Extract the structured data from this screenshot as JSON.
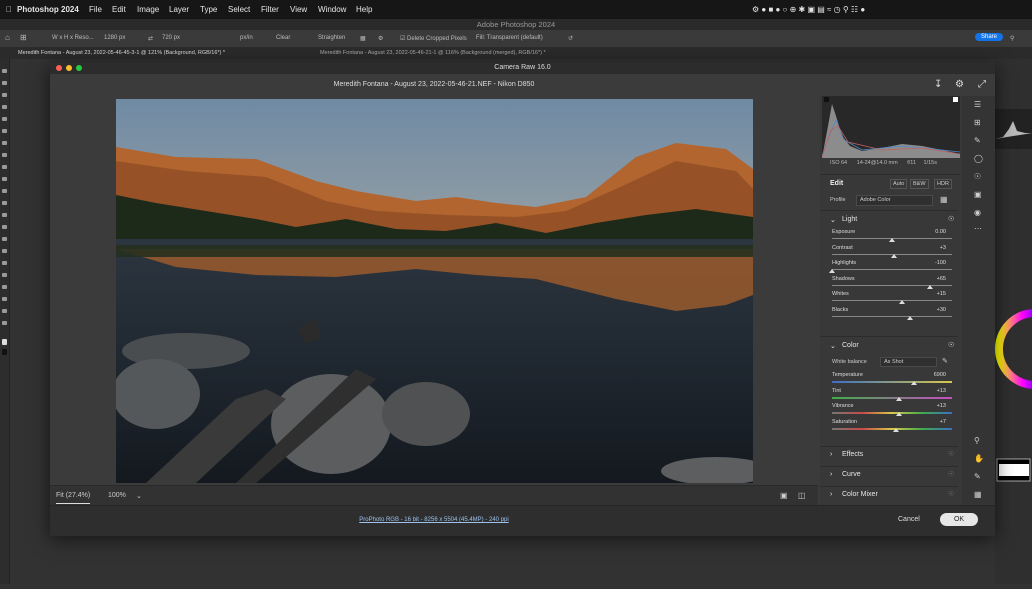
{
  "menubar": {
    "app": "Photoshop 2024",
    "items": [
      "File",
      "Edit",
      "Image",
      "Layer",
      "Type",
      "Select",
      "Filter",
      "View",
      "Window",
      "Help"
    ]
  },
  "ps_title": "Adobe Photoshop 2024",
  "options": {
    "ratio": "W x H x Reso...",
    "width": "1280 px",
    "height": "720 px",
    "unit": "px/in",
    "clear": "Clear",
    "straighten": "Straighten",
    "delete_cropped": "Delete Cropped Pixels",
    "fill": "Fill: Transparent (default)",
    "share": "Share"
  },
  "tabs": [
    "Meredith Fontana - August 23, 2022-05-46-45-3-1 @ 121% (Background, RGB/16*) *",
    "Meredith Fontana - August 23, 2022-05-46-21-1 @ 116% (Background (merged), RGB/16*) *"
  ],
  "camera_raw": {
    "title": "Camera Raw 16.0",
    "file_title": "Meredith Fontana - August 23, 2022-05-46-21.NEF  -  Nikon D850",
    "zoom_fit": "Fit (27.4%)",
    "zoom_100": "100%",
    "footer_info": "ProPhoto RGB - 16 bit - 8256 x 5504 (45.4MP) - 240 ppi",
    "cancel": "Cancel",
    "ok": "OK"
  },
  "meta": {
    "iso": "ISO 64",
    "lens": "14-24@14.0 mm",
    "aperture": "f/11",
    "shutter": "1/15s"
  },
  "edit": {
    "title": "Edit",
    "auto": "Auto",
    "bw": "B&W",
    "hdr": "HDR",
    "profile_label": "Profile",
    "profile_value": "Adobe Color"
  },
  "light": {
    "title": "Light",
    "sliders": [
      {
        "label": "Exposure",
        "value": "0.00",
        "pos": 0.5
      },
      {
        "label": "Contrast",
        "value": "+3",
        "pos": 0.52
      },
      {
        "label": "Highlights",
        "value": "-100",
        "pos": 0.0
      },
      {
        "label": "Shadows",
        "value": "+65",
        "pos": 0.82
      },
      {
        "label": "Whites",
        "value": "+15",
        "pos": 0.58
      },
      {
        "label": "Blacks",
        "value": "+30",
        "pos": 0.65
      }
    ]
  },
  "color": {
    "title": "Color",
    "wb_label": "White balance",
    "wb_value": "As Shot",
    "sliders": [
      {
        "label": "Temperature",
        "value": "6900",
        "pos": 0.68
      },
      {
        "label": "Tint",
        "value": "+13",
        "pos": 0.56
      },
      {
        "label": "Vibrance",
        "value": "+13",
        "pos": 0.56
      },
      {
        "label": "Saturation",
        "value": "+7",
        "pos": 0.53
      }
    ]
  },
  "collapsed_sections": [
    "Effects",
    "Curve",
    "Color Mixer"
  ],
  "colors": {
    "accent": "#1473e6",
    "panel": "#383838",
    "dialog": "#3b3b3b"
  }
}
